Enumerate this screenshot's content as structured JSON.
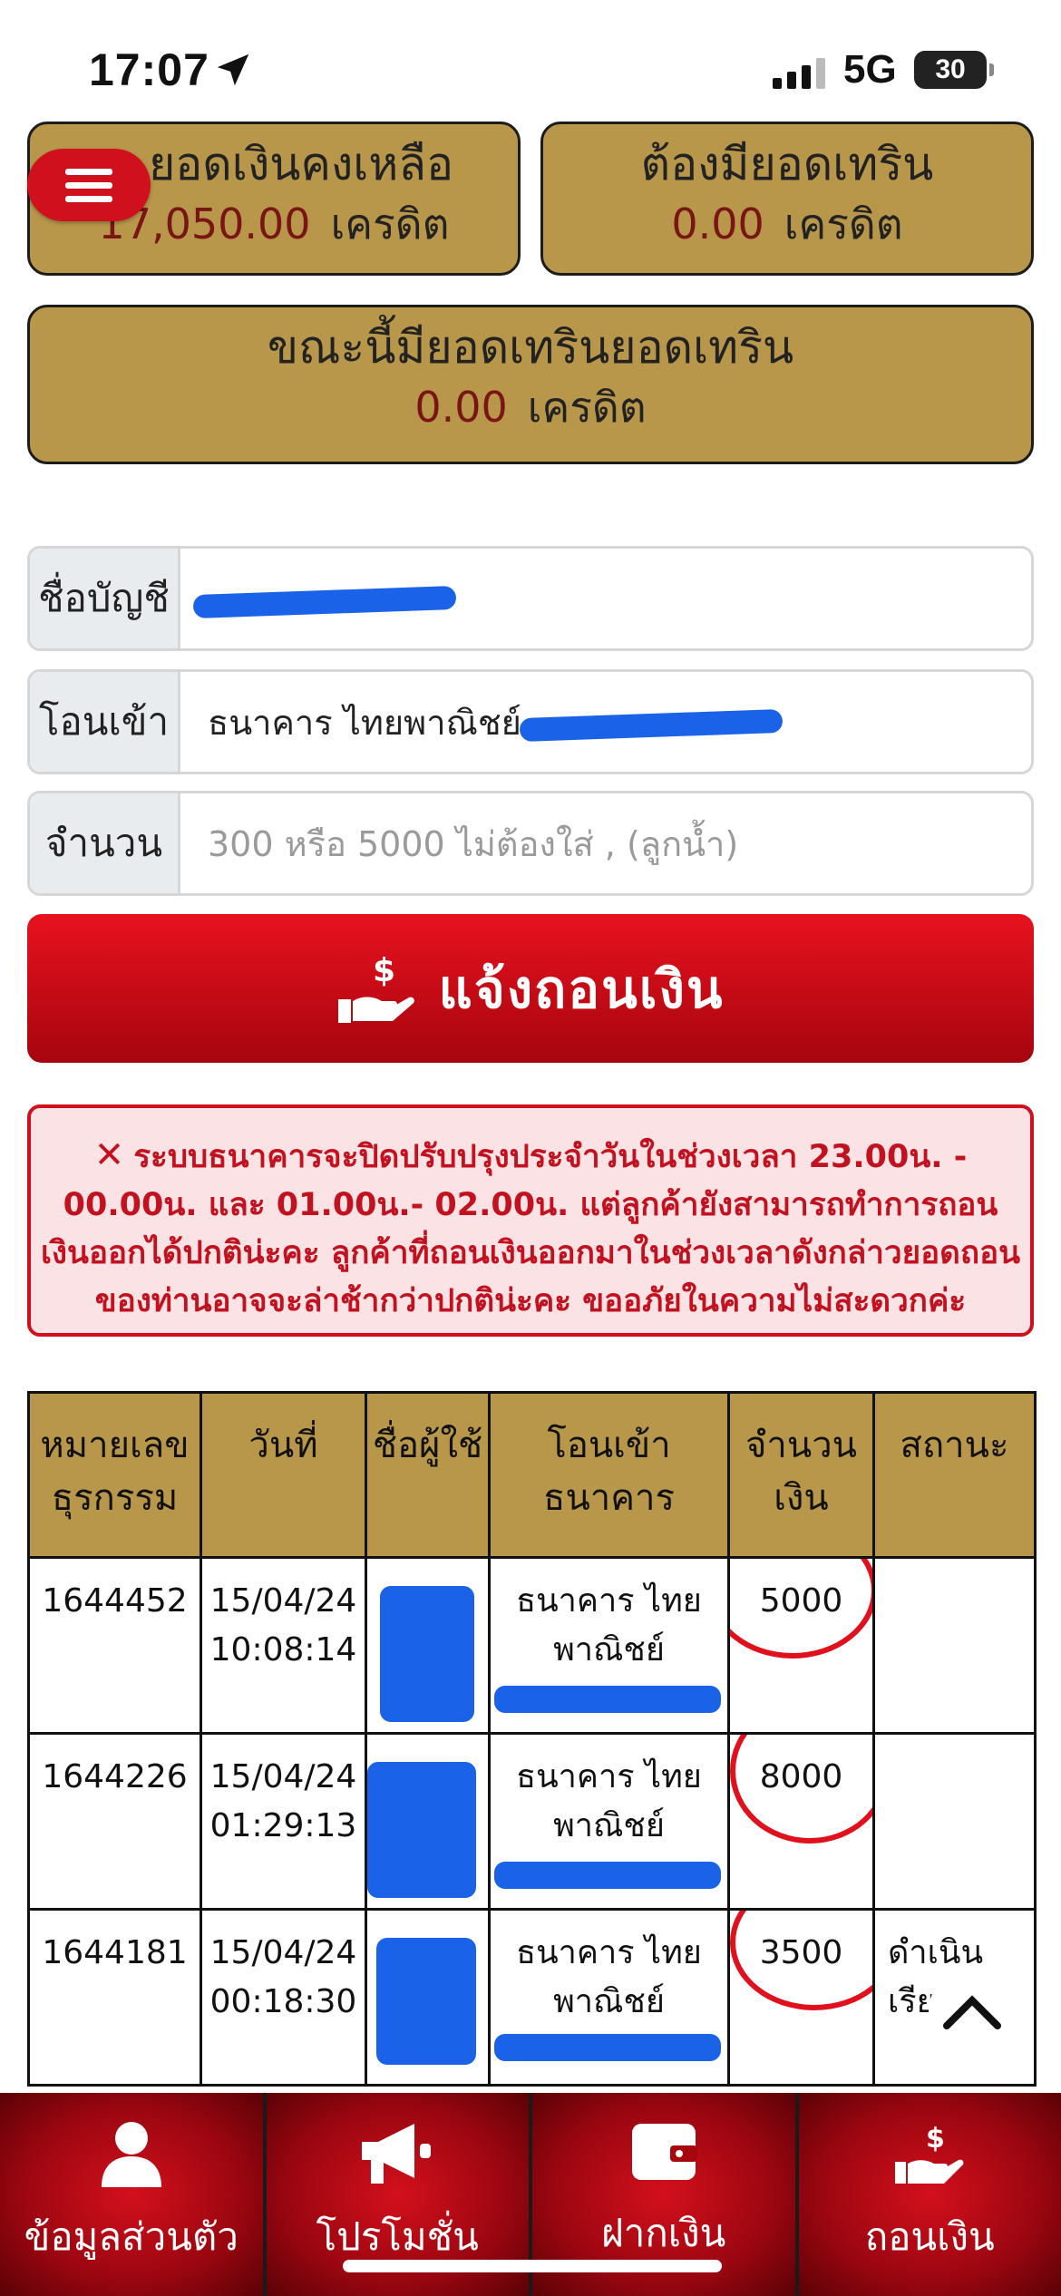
{
  "status_bar": {
    "time": "17:07",
    "network": "5G",
    "battery": "30"
  },
  "balance_cards": {
    "balance": {
      "title": "ยอดเงินคงเหลือ",
      "value": "17,050.00",
      "unit": "เครดิต"
    },
    "required_turnover": {
      "title": "ต้องมียอดเทริน",
      "value": "0.00",
      "unit": "เครดิต"
    },
    "current_turnover": {
      "title": "ขณะนี้มียอดเทรินยอดเทริน",
      "value": "0.00",
      "unit": "เครดิต"
    }
  },
  "form": {
    "account_name_label": "ชื่อบัญชี",
    "transfer_to_label": "โอนเข้า",
    "transfer_to_value": "ธนาคาร ไทยพาณิชย์",
    "amount_label": "จำนวน",
    "amount_placeholder": "300 หรือ 5000 ไม่ต้องใส่ , (ลูกน้ำ)",
    "submit_label": "แจ้งถอนเงิน"
  },
  "alert": {
    "icon": "✕",
    "text": "ระบบธนาคารจะปิดปรับปรุงประจำวันในช่วงเวลา 23.00น. - 00.00น. และ 01.00น.- 02.00น. แต่ลูกค้ายังสามารถทำการถอนเงินออกได้ปกติน่ะคะ ลูกค้าที่ถอนเงินออกมาในช่วงเวลาดังกล่าวยอดถอนของท่านอาจจะล่าช้ากว่าปกติน่ะคะ ขออภัยในความไม่สะดวกค่ะ"
  },
  "table": {
    "headers": [
      "หมายเลข ธุรกรรม",
      "วันที่",
      "ชื่อผู้ใช้",
      "โอนเข้า ธนาคาร",
      "จำนวน เงิน",
      "สถานะ"
    ],
    "rows": [
      {
        "id": "1644452",
        "date": "15/04/24",
        "time": "10:08:14",
        "bank": "ธนาคาร ไทย",
        "bank2": "พาณิชย์",
        "amount": "5000",
        "status": ""
      },
      {
        "id": "1644226",
        "date": "15/04/24",
        "time": "01:29:13",
        "bank": "ธนาคาร ไทย",
        "bank2": "พาณิชย์",
        "amount": "8000",
        "status": ""
      },
      {
        "id": "1644181",
        "date": "15/04/24",
        "time": "00:18:30",
        "bank": "ธนาคาร ไทย",
        "bank2": "พาณิชย์",
        "amount": "3500",
        "status": "ดำเนิน เรีย"
      }
    ]
  },
  "bottom_nav": [
    {
      "label": "ข้อมูลส่วนตัว",
      "icon": "user-icon"
    },
    {
      "label": "โปรโมชั่น",
      "icon": "megaphone-icon"
    },
    {
      "label": "ฝากเงิน",
      "icon": "wallet-icon"
    },
    {
      "label": "ถอนเงิน",
      "icon": "withdraw-hand-icon"
    }
  ],
  "colors": {
    "gold": "#b8974b",
    "red": "#d0101c",
    "dark_red_value": "#7a1515",
    "redaction_blue": "#1a63e8"
  }
}
